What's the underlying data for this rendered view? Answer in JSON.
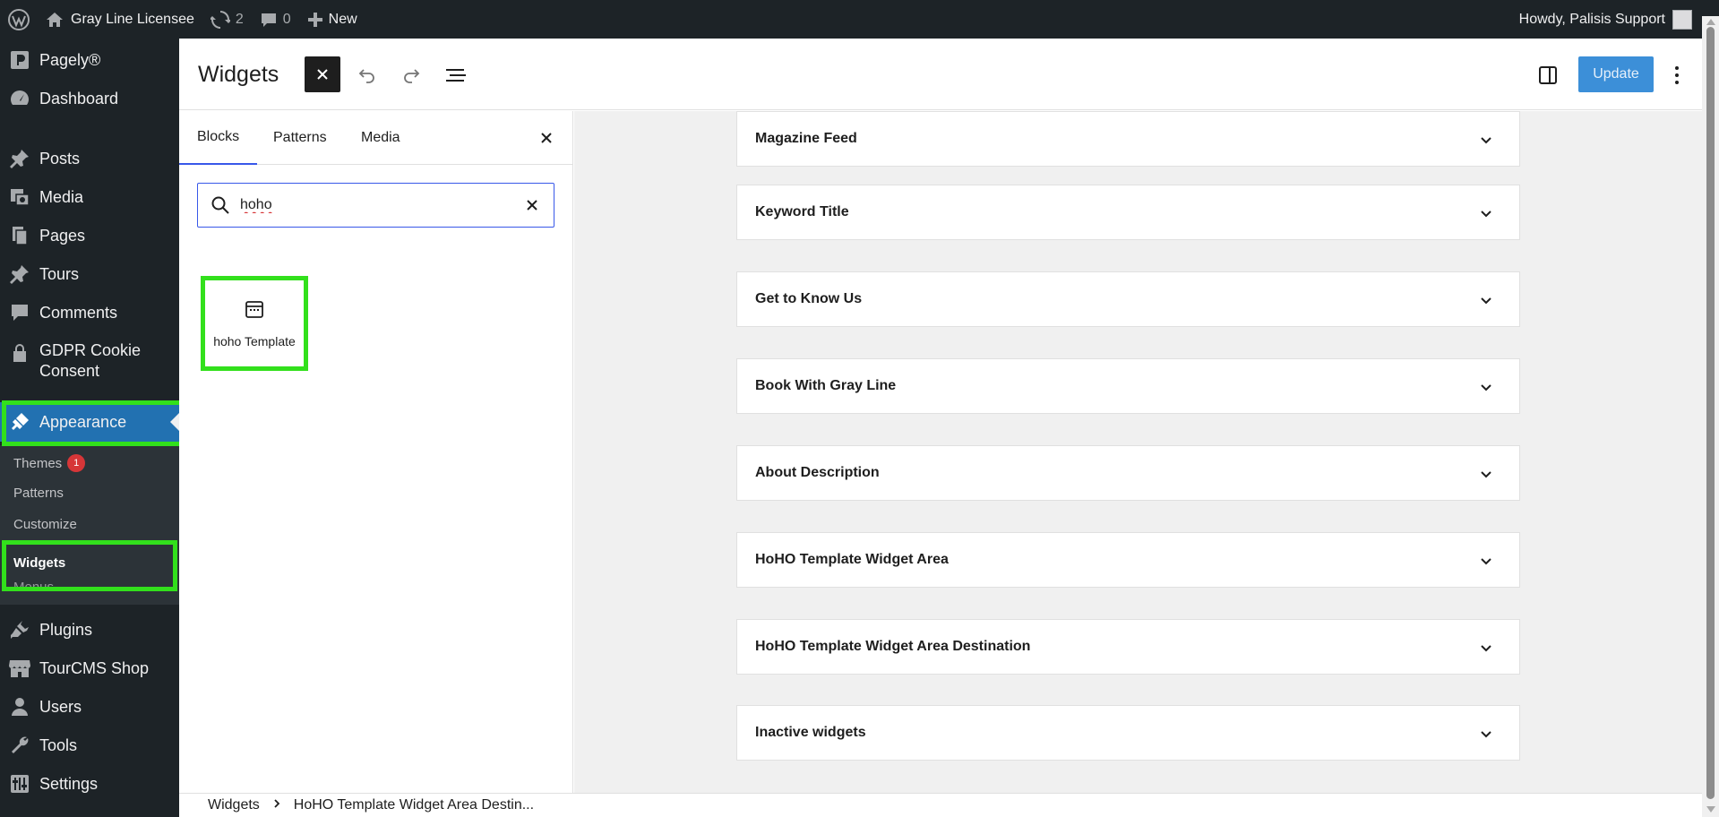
{
  "admin_bar": {
    "site_name": "Gray Line Licensee",
    "updates_count": "2",
    "comments_count": "0",
    "new_label": "New",
    "greeting": "Howdy, Palisis Support"
  },
  "sidebar": {
    "items": [
      {
        "label": "Pagely®",
        "icon": "pagely-icon"
      },
      {
        "label": "Dashboard",
        "icon": "dashboard-icon"
      },
      {
        "label": "Posts",
        "icon": "pin-icon"
      },
      {
        "label": "Media",
        "icon": "media-icon"
      },
      {
        "label": "Pages",
        "icon": "pages-icon"
      },
      {
        "label": "Tours",
        "icon": "pin-icon"
      },
      {
        "label": "Comments",
        "icon": "comment-icon"
      },
      {
        "label": "GDPR Cookie Consent",
        "icon": "lock-icon"
      },
      {
        "label": "Appearance",
        "icon": "brush-icon"
      },
      {
        "label": "Plugins",
        "icon": "plugin-icon"
      },
      {
        "label": "TourCMS Shop",
        "icon": "store-icon"
      },
      {
        "label": "Users",
        "icon": "user-icon"
      },
      {
        "label": "Tools",
        "icon": "wrench-icon"
      },
      {
        "label": "Settings",
        "icon": "settings-icon"
      }
    ],
    "appearance_submenu": [
      {
        "label": "Themes",
        "badge": "1"
      },
      {
        "label": "Patterns"
      },
      {
        "label": "Customize"
      },
      {
        "label": "Widgets"
      },
      {
        "label": "Menus"
      }
    ]
  },
  "header": {
    "title": "Widgets",
    "update_label": "Update"
  },
  "inserter": {
    "tabs": [
      "Blocks",
      "Patterns",
      "Media"
    ],
    "active_tab": "Blocks",
    "search_value": "hoho",
    "results": [
      {
        "label": "hoho Template",
        "icon": "calendar-icon"
      }
    ]
  },
  "widget_areas": [
    "Magazine Feed",
    "Keyword Title",
    "Get to Know Us",
    "Book With Gray Line",
    "About Description",
    "HoHO Template Widget Area",
    "HoHO Template Widget Area Destination",
    "Inactive widgets"
  ],
  "breadcrumb": {
    "root": "Widgets",
    "current": "HoHO Template Widget Area Destin..."
  },
  "colors": {
    "admin_bg": "#1d2327",
    "accent": "#2271b1",
    "highlight": "#32e01c",
    "update_button": "#3c8fd8"
  }
}
